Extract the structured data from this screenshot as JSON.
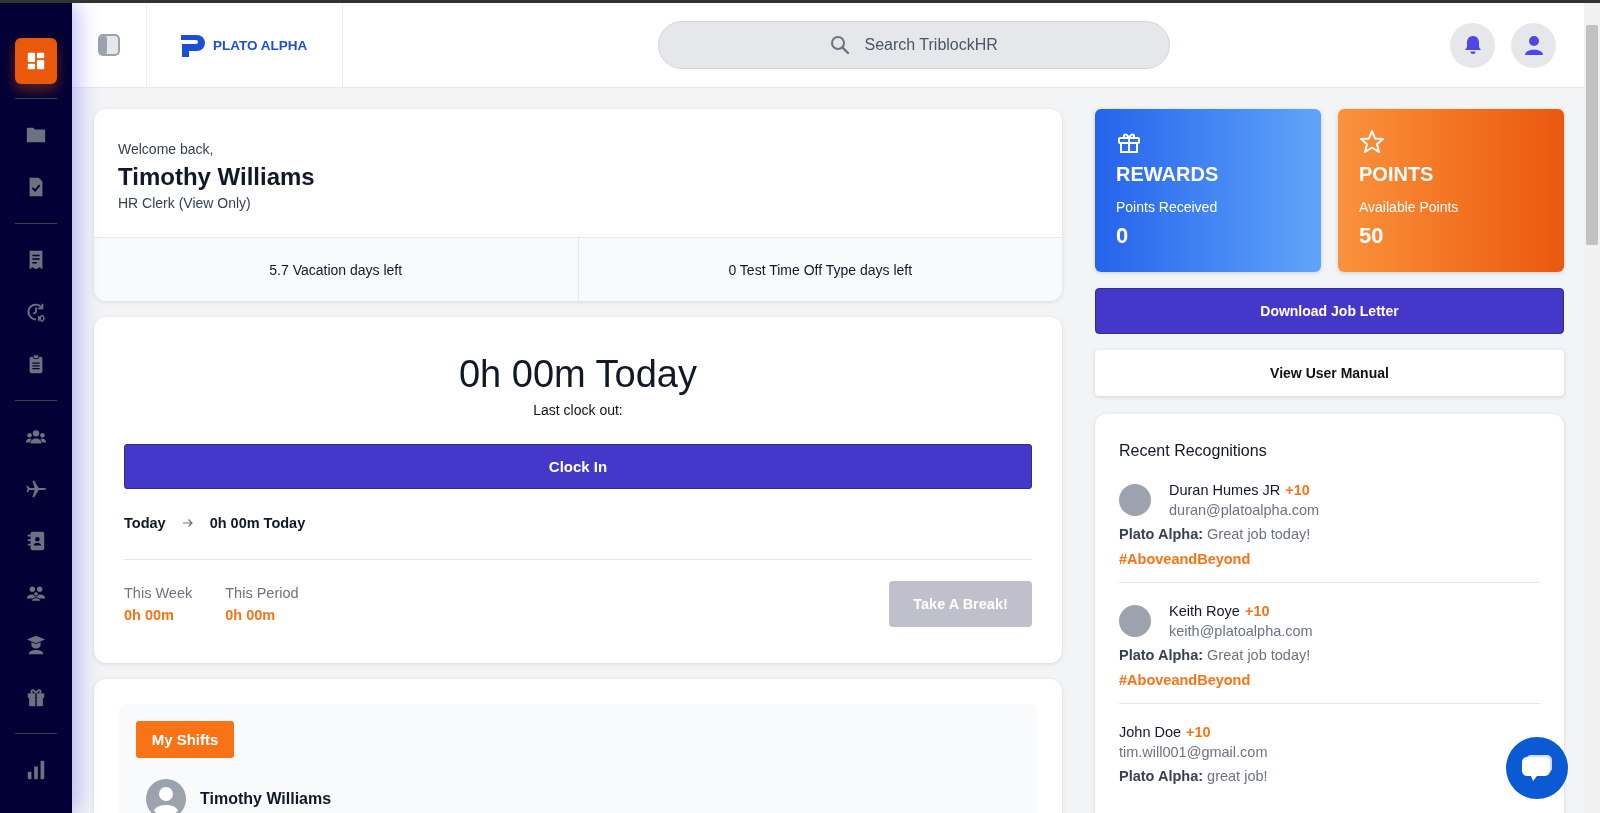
{
  "sidebar": {
    "groups": [
      [
        {
          "kind": "dashboard",
          "selected": true
        }
      ],
      [
        {
          "kind": "folder",
          "selected": false
        },
        {
          "kind": "document-check",
          "selected": false
        }
      ],
      [
        {
          "kind": "receipt",
          "selected": false
        },
        {
          "kind": "clock-ten",
          "selected": false
        },
        {
          "kind": "clipboard",
          "selected": false
        }
      ],
      [
        {
          "kind": "people",
          "selected": false
        },
        {
          "kind": "plane",
          "selected": false
        },
        {
          "kind": "contact",
          "selected": false
        },
        {
          "kind": "team",
          "selected": false
        },
        {
          "kind": "graduate",
          "selected": false
        },
        {
          "kind": "gift",
          "selected": false
        }
      ],
      [
        {
          "kind": "chart",
          "selected": false
        }
      ]
    ]
  },
  "header": {
    "logo_text": "PLATO ALPHA",
    "search": {
      "placeholder": "Search TriblockHR"
    }
  },
  "welcome": {
    "greeting": "Welcome back,",
    "name": "Timothy Williams",
    "role": "HR Clerk (View Only)",
    "balances": [
      "5.7 Vacation days left",
      "0 Test Time Off Type days left"
    ]
  },
  "clock": {
    "total": "0h 00m Today",
    "last_clock_out": "Last clock out:",
    "clock_in_button": "Clock In",
    "today_label": "Today",
    "today_value": "0h 00m Today",
    "stats": [
      {
        "label": "This Week",
        "value": "0h 00m"
      },
      {
        "label": "This Period",
        "value": "0h 00m"
      }
    ],
    "break_button": {
      "label": "Take A Break!",
      "disabled": true
    }
  },
  "shifts": {
    "tab": "My Shifts",
    "employee": "Timothy Williams"
  },
  "cards": [
    {
      "kind": "rewards",
      "title": "REWARDS",
      "subtitle": "Points Received",
      "value": "0"
    },
    {
      "kind": "points",
      "title": "POINTS",
      "subtitle": "Available Points",
      "value": "50"
    }
  ],
  "actions": [
    {
      "kind": "primary",
      "label": "Download Job Letter"
    },
    {
      "kind": "secondary",
      "label": "View User Manual"
    }
  ],
  "recognitions": {
    "title": "Recent Recognitions",
    "items": [
      {
        "photo": true,
        "name": "Duran Humes JR",
        "points": "+10",
        "email": "duran@platoalpha.com",
        "message": "**Plato Alpha:** Great job today!",
        "tag": "#AboveandBeyond"
      },
      {
        "photo": true,
        "name": "Keith Roye",
        "points": "+10",
        "email": "keith@platoalpha.com",
        "message": "**Plato Alpha:** Great job today!",
        "tag": "#AboveandBeyond"
      },
      {
        "photo": false,
        "name": "John Doe",
        "points": "+10",
        "email": "tim.will001@gmail.com",
        "message": "**Plato Alpha:** great job!"
      }
    ]
  }
}
